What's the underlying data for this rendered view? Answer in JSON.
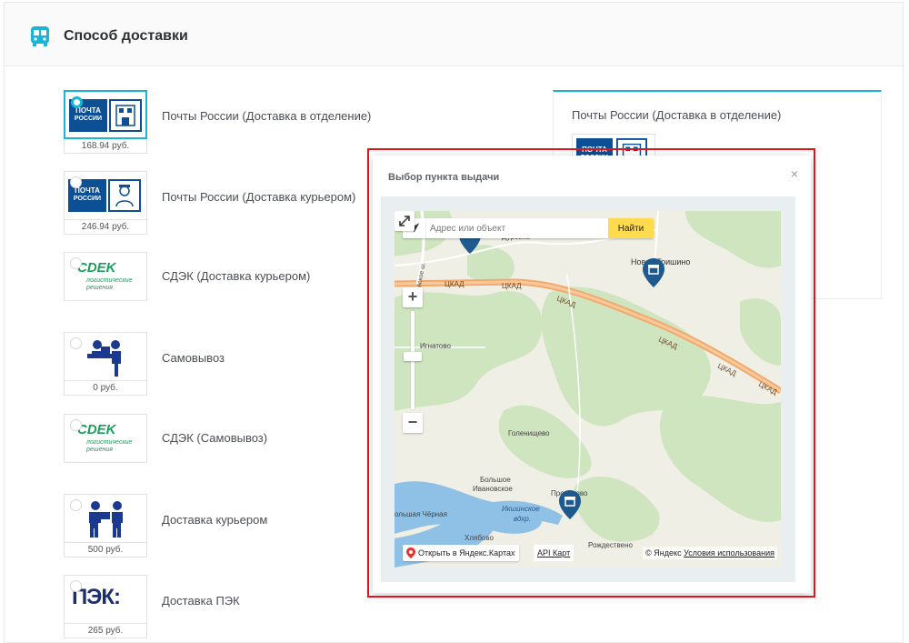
{
  "section": {
    "title": "Способ доставки",
    "icon": "bus-icon"
  },
  "options": [
    {
      "label": "Почты России (Доставка в отделение)",
      "price": "168.94 руб.",
      "logo": "pochta-rossii-office-logo",
      "selected": true
    },
    {
      "label": "Почты России (Доставка курьером)",
      "price": "246.94 руб.",
      "logo": "pochta-rossii-courier-logo",
      "selected": false
    },
    {
      "label": "СДЭК (Доставка курьером)",
      "price": "",
      "logo": "cdek-logo",
      "selected": false
    },
    {
      "label": "Самовывоз",
      "price": "0 руб.",
      "logo": "pickup-people-icon",
      "selected": false
    },
    {
      "label": "СДЭК (Самовывоз)",
      "price": "",
      "logo": "cdek-logo",
      "selected": false
    },
    {
      "label": "Доставка курьером",
      "price": "500 руб.",
      "logo": "courier-people-icon",
      "selected": false
    },
    {
      "label": "Доставка ПЭК",
      "price": "265 руб.",
      "logo": "pek-logo",
      "selected": false
    }
  ],
  "logo_text": {
    "pochta_line1": "ПОЧТА",
    "pochta_line2": "РОССИИ",
    "cdek_main": "СDEK",
    "cdek_sub1": "логистические",
    "cdek_sub2": "решения",
    "pek": "ПЭК:"
  },
  "summary": {
    "title": "Почты России (Доставка в отделение)"
  },
  "modal": {
    "title": "Выбор пункта выдачи",
    "close": "×"
  },
  "map": {
    "search_placeholder": "Адрес или объект",
    "find_label": "Найти",
    "open_label": "Открыть в Яндекс.Картах",
    "api_label": "API Карт",
    "copyright": "© Яндекс",
    "terms": "Условия использования",
    "places": {
      "kurovka": "Дуровка",
      "novoe_grishino": "Новое Гришино",
      "ignatovo": "Игнатово",
      "golenishchevo": "Голенищево",
      "bolshoe_ivanovskoe_1": "Большое",
      "bolshoe_ivanovskoe_2": "Ивановское",
      "ikshinskoe_1": "Икшинское",
      "ikshinskoe_2": "вдхр.",
      "bolshaya_chernaya": "ольшая Чёрная",
      "khlebovo": "Хлябово",
      "proshvo": "Прохорово",
      "rozhdestveno": "Рождествено"
    },
    "road_label": "ЦКАД",
    "colors": {
      "forest": "#cfe5c0",
      "field": "#f0efe5",
      "water": "#8fc1e6",
      "road": "#f3a96b",
      "pin": "#1f5a8e"
    }
  }
}
